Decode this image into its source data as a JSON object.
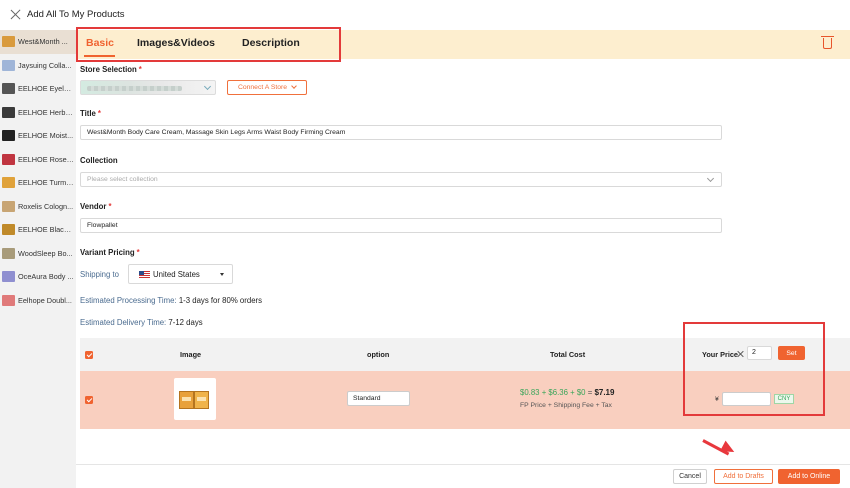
{
  "window": {
    "title": "Add All To My Products"
  },
  "sidebar": {
    "items": [
      {
        "label": "West&Month ...",
        "thumb_color": "#d99a3c",
        "active": true
      },
      {
        "label": "Jaysuing Colla...",
        "thumb_color": "#9fb5d8",
        "active": false
      },
      {
        "label": "EELHOE Eyelas...",
        "thumb_color": "#555555",
        "active": false
      },
      {
        "label": "EELHOE Herbal...",
        "thumb_color": "#3a3a3a",
        "active": false
      },
      {
        "label": "EELHOE Moist...",
        "thumb_color": "#222222",
        "active": false
      },
      {
        "label": "EELHOE Rose ...",
        "thumb_color": "#c03540",
        "active": false
      },
      {
        "label": "EELHOE Turme...",
        "thumb_color": "#e0a23a",
        "active": false
      },
      {
        "label": "Roxelis Cologn...",
        "thumb_color": "#c8a574",
        "active": false
      },
      {
        "label": "EELHOE Black ...",
        "thumb_color": "#c08a2a",
        "active": false
      },
      {
        "label": "WoodSleep Bo...",
        "thumb_color": "#a89b7a",
        "active": false
      },
      {
        "label": "OceAura Body ...",
        "thumb_color": "#8f8fd0",
        "active": false
      },
      {
        "label": "Eelhope Doubl...",
        "thumb_color": "#e07a7a",
        "active": false
      }
    ]
  },
  "tabs": [
    {
      "label": "Basic",
      "active": true
    },
    {
      "label": "Images&Videos",
      "active": false
    },
    {
      "label": "Description",
      "active": false
    }
  ],
  "form": {
    "store_selection_label": "Store Selection",
    "required_mark": "*",
    "connect_store_label": "Connect A Store",
    "title_label": "Title",
    "title_value": "West&Month Body Care Cream, Massage Skin Legs Arms Waist Body Firming Cream",
    "collection_label": "Collection",
    "collection_placeholder": "Please select collection",
    "vendor_label": "Vendor",
    "vendor_value": "Flowpallet",
    "variant_pricing_label": "Variant Pricing",
    "shipping_to_label": "Shipping to",
    "shipping_country": "United States",
    "processing_label": "Estimated Processing Time:",
    "processing_value": "1-3 days for 80% orders",
    "delivery_label": "Estimated Delivery Time:",
    "delivery_value": "7-12 days"
  },
  "table": {
    "headers": {
      "image": "Image",
      "option": "option",
      "total_cost": "Total Cost",
      "your_price": "Your Price"
    },
    "multiplier_value": "2",
    "set_label": "Set",
    "rows": [
      {
        "option_value": "Standard",
        "fp_price": "$0.83",
        "plus1": "+",
        "shipping_fee": "$6.36",
        "plus2": "+",
        "tax": "$0",
        "equals": "=",
        "total": "$7.19",
        "cost_breakdown": "FP Price + Shipping Fee + Tax",
        "currency_symbol": "¥",
        "currency": "CNY"
      }
    ]
  },
  "footer": {
    "cancel_label": "Cancel",
    "drafts_label": "Add to Drafts",
    "online_label": "Add to Online"
  },
  "colors": {
    "accent": "#f06330",
    "highlight_border": "#e33a3a",
    "tab_bar_bg": "#fdeecf",
    "row_bg": "#f9cfbf"
  }
}
